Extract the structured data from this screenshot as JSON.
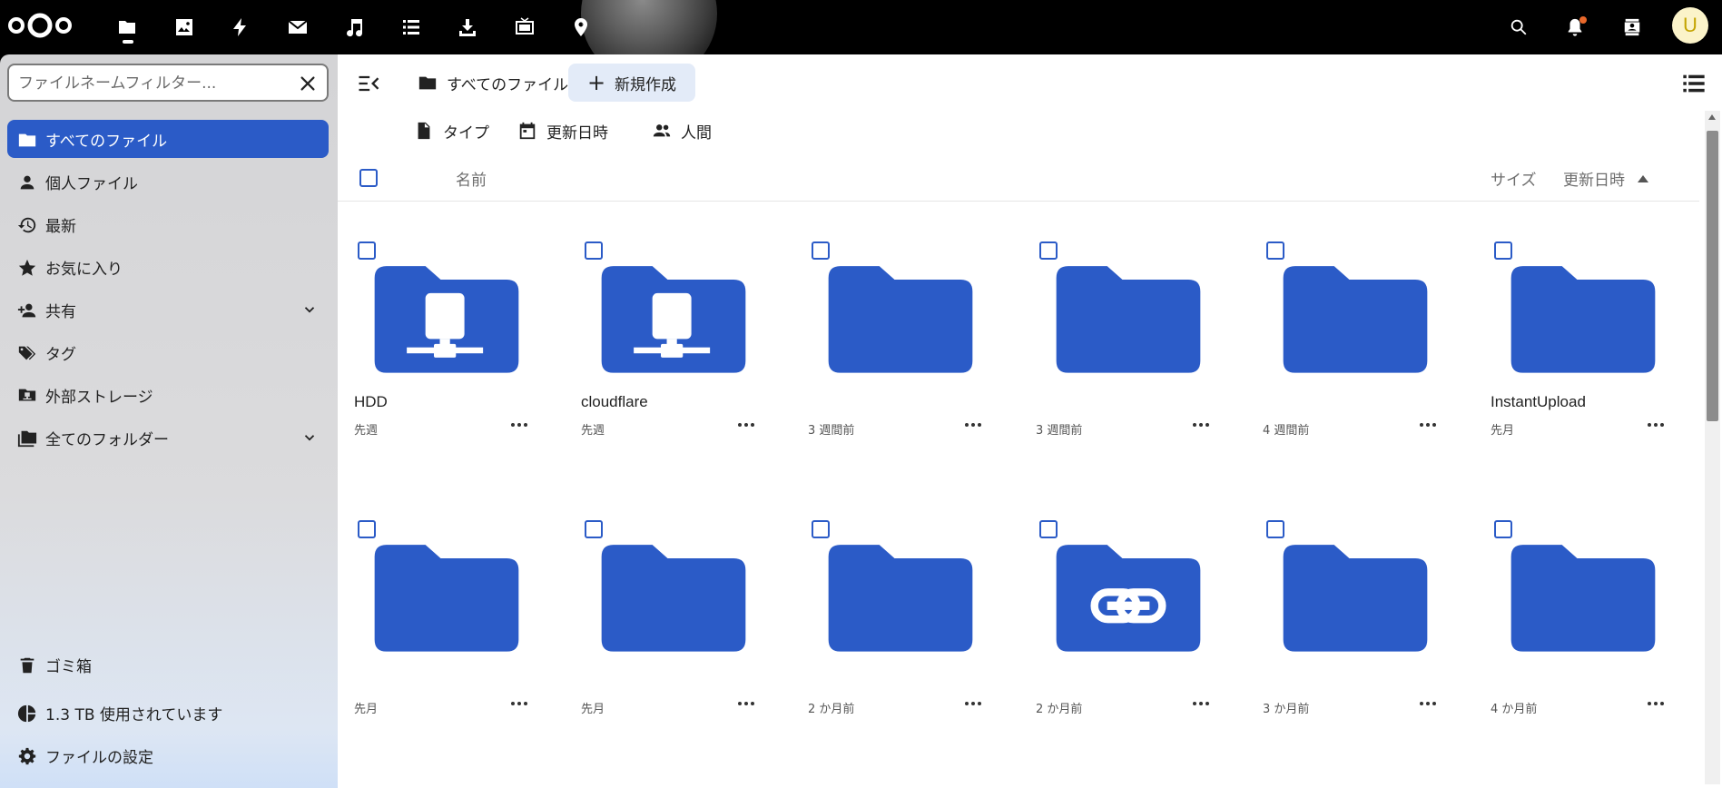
{
  "topbar": {
    "apps": [
      "files-icon",
      "photos-icon",
      "activity-icon",
      "mail-icon",
      "music-icon",
      "tasks-icon",
      "downloads-icon",
      "video-icon",
      "maps-icon"
    ],
    "right": [
      "search-icon",
      "notifications-icon",
      "contacts-icon"
    ],
    "avatar_initial": "U",
    "accent_color": "#2b5bc7"
  },
  "sidebar": {
    "filter_placeholder": "ファイルネームフィルター...",
    "items": [
      {
        "label": "すべてのファイル",
        "icon": "folder-icon",
        "active": true
      },
      {
        "label": "個人ファイル",
        "icon": "person-icon"
      },
      {
        "label": "最新",
        "icon": "history-icon"
      },
      {
        "label": "お気に入り",
        "icon": "star-icon"
      },
      {
        "label": "共有",
        "icon": "share-icon",
        "expandable": true
      },
      {
        "label": "タグ",
        "icon": "tag-icon"
      },
      {
        "label": "外部ストレージ",
        "icon": "external-storage-icon"
      },
      {
        "label": "全てのフォルダー",
        "icon": "folders-icon",
        "expandable": true
      }
    ],
    "footer": {
      "trash": "ゴミ箱",
      "quota": "1.3 TB 使用されています",
      "settings": "ファイルの設定"
    }
  },
  "main": {
    "breadcrumb": "すべてのファイル",
    "new_label": "新規作成",
    "filters": {
      "type": "タイプ",
      "modified": "更新日時",
      "people": "人間"
    },
    "columns": {
      "name": "名前",
      "size": "サイズ",
      "modified": "更新日時"
    },
    "files": [
      {
        "name": "HDD",
        "date": "先週",
        "icon": "network-folder-icon"
      },
      {
        "name": "cloudflare",
        "date": "先週",
        "icon": "network-folder-icon"
      },
      {
        "name": "",
        "date": "3 週間前",
        "icon": "folder-icon"
      },
      {
        "name": "",
        "date": "3 週間前",
        "icon": "folder-icon"
      },
      {
        "name": "",
        "date": "4 週間前",
        "icon": "folder-icon"
      },
      {
        "name": "InstantUpload",
        "date": "先月",
        "icon": "folder-icon"
      },
      {
        "name": "",
        "date": "先月",
        "icon": "folder-icon"
      },
      {
        "name": "",
        "date": "先月",
        "icon": "folder-icon"
      },
      {
        "name": "",
        "date": "2 か月前",
        "icon": "folder-icon"
      },
      {
        "name": "",
        "date": "2 か月前",
        "icon": "link-folder-icon"
      },
      {
        "name": "",
        "date": "3 か月前",
        "icon": "folder-icon"
      },
      {
        "name": "",
        "date": "4 か月前",
        "icon": "folder-icon"
      }
    ]
  }
}
